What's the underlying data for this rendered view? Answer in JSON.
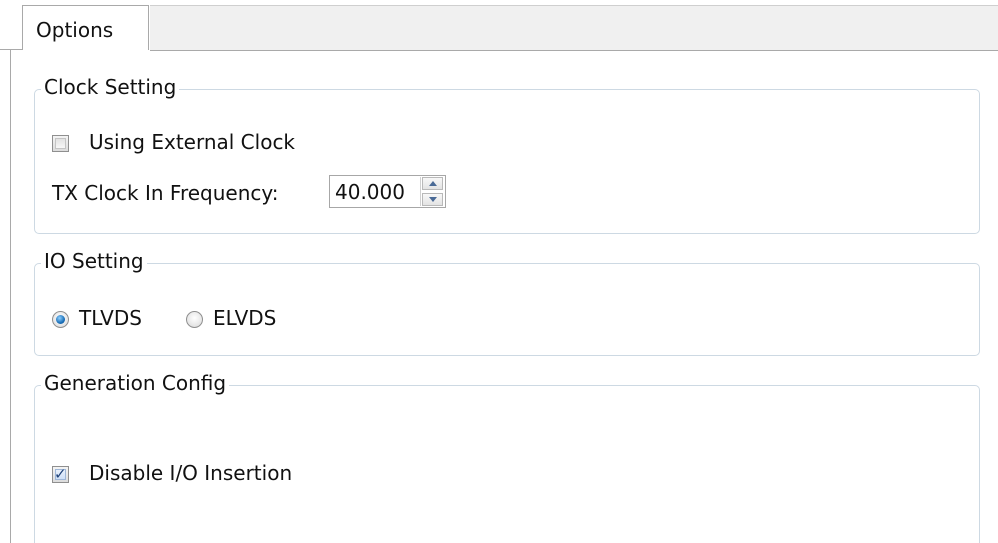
{
  "tabs": [
    {
      "label": "Options"
    }
  ],
  "clock_setting": {
    "title": "Clock Setting",
    "external_clock": {
      "label": "Using External Clock",
      "checked": false
    },
    "tx_clock": {
      "label": "TX Clock In Frequency:",
      "value": "40.000"
    }
  },
  "io_setting": {
    "title": "IO Setting",
    "options": [
      {
        "label": "TLVDS",
        "selected": true
      },
      {
        "label": "ELVDS",
        "selected": false
      }
    ]
  },
  "generation_config": {
    "title": "Generation Config",
    "disable_io_insertion": {
      "label": "Disable I/O Insertion",
      "checked": true
    }
  },
  "colors": {
    "group_border": "#cdd9e3",
    "tab_border": "#a9a9a9",
    "radio_selected": "#1a6fb8"
  }
}
